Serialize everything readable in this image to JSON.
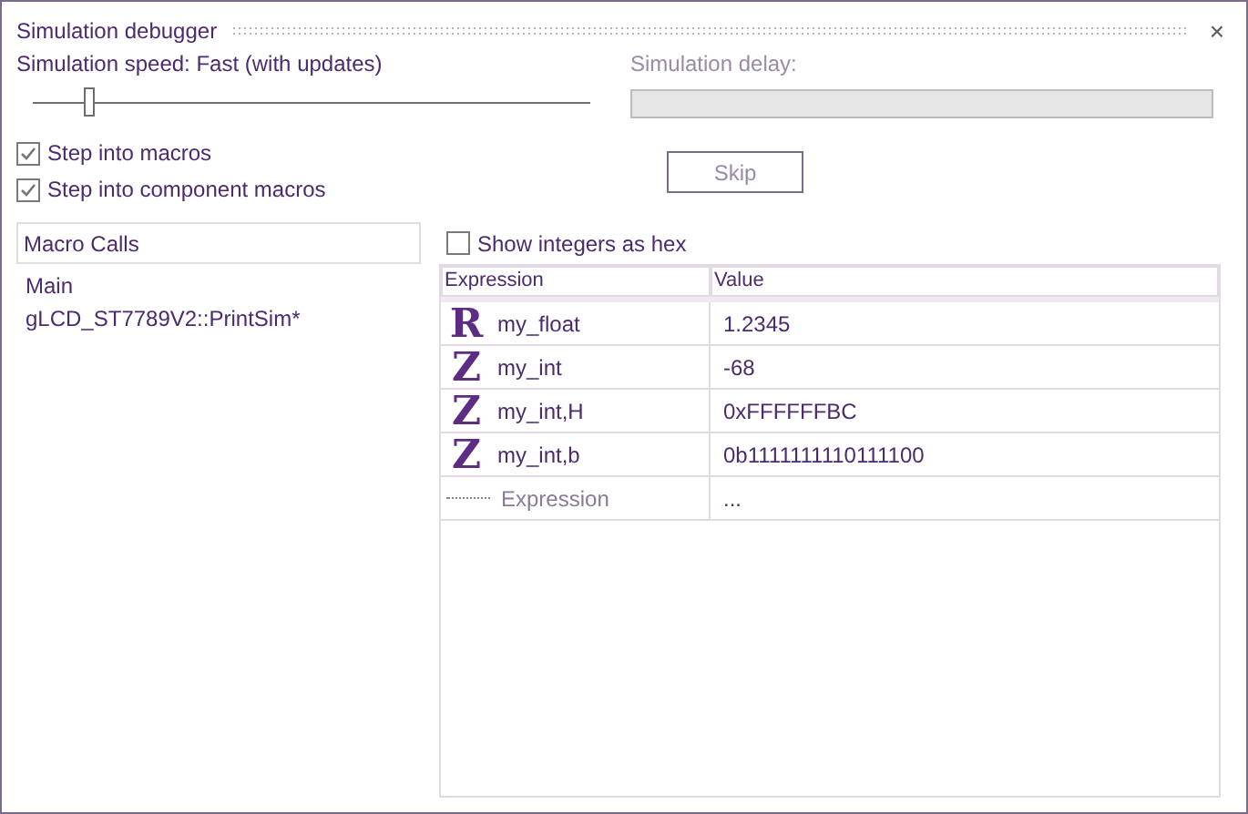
{
  "window": {
    "title": "Simulation debugger",
    "close": "×"
  },
  "speed": {
    "label": "Simulation speed: Fast (with updates)",
    "level": 0.1
  },
  "delay": {
    "label": "Simulation delay:",
    "disabled": true
  },
  "options": [
    {
      "label": "Step into macros",
      "checked": true
    },
    {
      "label": "Step into component macros",
      "checked": true
    }
  ],
  "skip_button": {
    "label": "Skip",
    "disabled": true
  },
  "macro_calls": {
    "heading": "Macro Calls",
    "items": [
      "Main",
      "gLCD_ST7789V2::PrintSim*"
    ]
  },
  "hex_option": {
    "label": "Show integers as hex",
    "checked": false
  },
  "table": {
    "columns": [
      "Expression",
      "Value"
    ],
    "rows": [
      {
        "kind": "variable",
        "type": "R",
        "expression": "my_float",
        "value": "1.2345"
      },
      {
        "kind": "variable",
        "type": "Z",
        "expression": "my_int",
        "value": "-68"
      },
      {
        "kind": "variable",
        "type": "Z",
        "expression": "my_int,H",
        "value": "0xFFFFFFBC"
      },
      {
        "kind": "variable",
        "type": "Z",
        "expression": "my_int,b",
        "value": "0b1111111110111100"
      },
      {
        "kind": "new",
        "expression": "Expression",
        "value": "..."
      }
    ]
  }
}
